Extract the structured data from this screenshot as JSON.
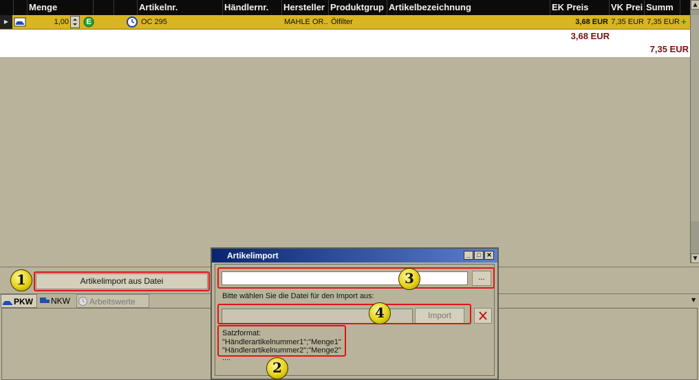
{
  "grid": {
    "columns": [
      "Menge",
      "Artikelnr.",
      "Händlernr.",
      "Hersteller",
      "Produktgrup",
      "Artikelbezeichnung",
      "EK Preis",
      "VK Prei",
      "Summ"
    ],
    "row": {
      "menge": "1,00",
      "badge": "E",
      "artikelnr": "OC 295",
      "hersteller": "MAHLE OR...",
      "produktgruppe": "Ölfilter",
      "ek_preis": "3,68 EUR",
      "vk_preis": "7,35 EUR",
      "summe": "7,35 EUR"
    },
    "totals": {
      "ek": "3,68 EUR",
      "vk": "7,35 EUR"
    }
  },
  "bottom": {
    "import_button": "Artikelimport aus Datei"
  },
  "tabs": [
    {
      "label": "PKW",
      "icon": "car-icon"
    },
    {
      "label": "NKW",
      "icon": "truck-icon"
    },
    {
      "label": "Arbeitswerte",
      "icon": "clock-icon"
    }
  ],
  "dialog": {
    "title": "Artikelimport",
    "file_input_value": "",
    "browse_label": "...",
    "instruction": "Bitte wählen Sie die Datei für den Import aus:",
    "import_button": "Import",
    "format_label": "Satzformat:",
    "format_line1": "\"Händlerartikelnummer1\";\"Menge1\"",
    "format_line2": "\"Händlerartikelnummer2\";\"Menge2\"",
    "format_more": "...."
  },
  "callouts": [
    "1",
    "2",
    "3",
    "4"
  ],
  "colors": {
    "highlight_row": "#d9b521",
    "callout_border": "#e01414",
    "totals": "#7a1010",
    "title_bar": "#0a2570"
  }
}
